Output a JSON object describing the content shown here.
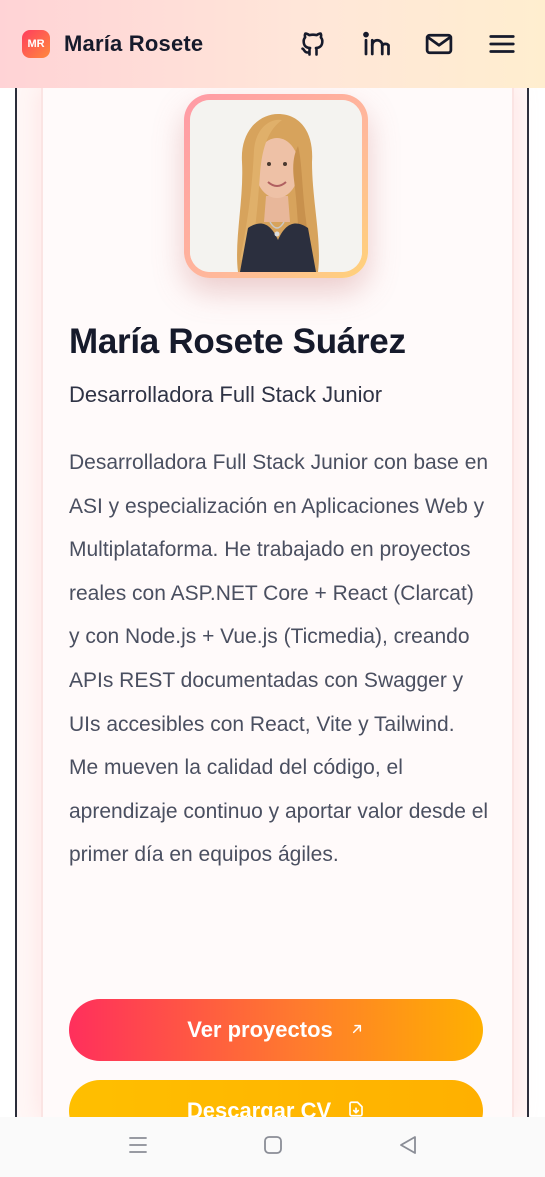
{
  "header": {
    "logo_text": "MR",
    "brand": "María Rosete",
    "icons": [
      "github-icon",
      "linkedin-icon",
      "mail-icon",
      "menu-icon"
    ]
  },
  "profile": {
    "name": "María Rosete Suárez",
    "role": "Desarrolladora Full Stack Junior",
    "bio": "Desarrolladora Full Stack Junior con base en ASI y especialización en Aplicaciones Web y Multiplataforma. He trabajado en proyectos reales con ASP.NET Core + React (Clarcat) y con Node.js + Vue.js (Ticmedia), creando APIs REST documentadas con Swagger y UIs accesibles con React, Vite y Tailwind. Me mueven la calidad del código, el aprendizaje continuo y aportar valor desde el primer día en equipos ágiles."
  },
  "buttons": {
    "primary_label": "Ver proyectos",
    "secondary_label": "Descargar CV"
  },
  "colors": {
    "accent_start": "#ff2f5c",
    "accent_end": "#ffb000",
    "text_dark": "#161a2b"
  }
}
